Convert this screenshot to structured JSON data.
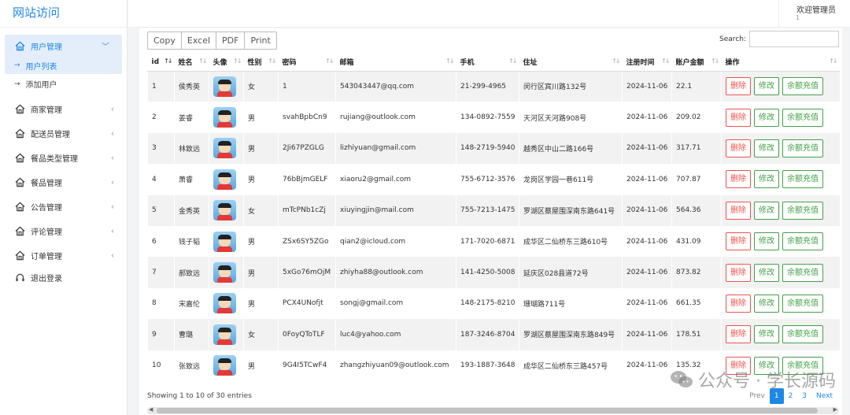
{
  "sidebar": {
    "logo": "网站访问",
    "items": [
      {
        "label": "用户管理",
        "icon": "home-icon",
        "expanded": true
      },
      {
        "label": "商家管理",
        "icon": "home-icon"
      },
      {
        "label": "配送员管理",
        "icon": "home-icon"
      },
      {
        "label": "餐品类型管理",
        "icon": "home-icon"
      },
      {
        "label": "餐品管理",
        "icon": "home-icon"
      },
      {
        "label": "公告管理",
        "icon": "home-icon"
      },
      {
        "label": "评论管理",
        "icon": "home-icon"
      },
      {
        "label": "订单管理",
        "icon": "home-icon"
      },
      {
        "label": "退出登录",
        "icon": "headset-icon"
      }
    ],
    "sub_items": [
      {
        "label": "用户列表"
      },
      {
        "label": "添加用户"
      }
    ]
  },
  "header": {
    "welcome": "欢迎管理员",
    "sub": "1"
  },
  "toolbar": {
    "copy": "Copy",
    "excel": "Excel",
    "pdf": "PDF",
    "print": "Print",
    "search_label": "Search:",
    "search_value": ""
  },
  "table": {
    "columns": [
      "id",
      "姓名",
      "头像",
      "性别",
      "密码",
      "邮箱",
      "手机",
      "住址",
      "注册时间",
      "账户金额",
      "操作"
    ],
    "rows": [
      {
        "id": "1",
        "name": "侯秀英",
        "gender": "女",
        "password": "1",
        "email": "543043447@qq.com",
        "phone": "21-299-4965",
        "address": "闵行区宾川路132号",
        "date": "2024-11-06",
        "balance": "22.1"
      },
      {
        "id": "2",
        "name": "姜睿",
        "gender": "男",
        "password": "svahBpbCn9",
        "email": "rujiang@outlook.com",
        "phone": "134-0892-7559",
        "address": "天河区天河路908号",
        "date": "2024-11-06",
        "balance": "209.02"
      },
      {
        "id": "3",
        "name": "林致远",
        "gender": "男",
        "password": "2Ji67PZGLG",
        "email": "lizhiyuan@gmail.com",
        "phone": "148-2719-5940",
        "address": "越秀区中山二路166号",
        "date": "2024-11-06",
        "balance": "317.71"
      },
      {
        "id": "4",
        "name": "萧睿",
        "gender": "男",
        "password": "76bBjmGELF",
        "email": "xiaoru2@gmail.com",
        "phone": "755-6712-3576",
        "address": "龙岗区学园一巷611号",
        "date": "2024-11-06",
        "balance": "707.87"
      },
      {
        "id": "5",
        "name": "金秀英",
        "gender": "女",
        "password": "mTcPNb1cZj",
        "email": "xiuyingjin@mail.com",
        "phone": "755-7213-1475",
        "address": "罗湖区蔡屋围深南东路641号",
        "date": "2024-11-06",
        "balance": "564.36"
      },
      {
        "id": "6",
        "name": "钱子韬",
        "gender": "男",
        "password": "ZSx6SY5ZGo",
        "email": "qian2@icloud.com",
        "phone": "171-7020-6871",
        "address": "成华区二仙桥东三路610号",
        "date": "2024-11-06",
        "balance": "431.09"
      },
      {
        "id": "7",
        "name": "郝致远",
        "gender": "男",
        "password": "5xGo76mOjM",
        "email": "zhiyha88@outlook.com",
        "phone": "141-4250-5008",
        "address": "延庆区028县道72号",
        "date": "2024-11-06",
        "balance": "873.82"
      },
      {
        "id": "8",
        "name": "宋嘉伦",
        "gender": "男",
        "password": "PCX4UNofjt",
        "email": "songj@gmail.com",
        "phone": "148-2175-8210",
        "address": "珊瑚路711号",
        "date": "2024-11-06",
        "balance": "661.35"
      },
      {
        "id": "9",
        "name": "曹璐",
        "gender": "女",
        "password": "0FoyQToTLF",
        "email": "luc4@yahoo.com",
        "phone": "187-3246-8704",
        "address": "罗湖区蔡屋围深南东路849号",
        "date": "2024-11-06",
        "balance": "178.51"
      },
      {
        "id": "10",
        "name": "张致远",
        "gender": "男",
        "password": "9G4I5TCwF4",
        "email": "zhangzhiyuan09@outlook.com",
        "phone": "193-1887-3648",
        "address": "成华区二仙桥东三路457号",
        "date": "2024-11-06",
        "balance": "135.32"
      }
    ],
    "actions": {
      "delete": "删除",
      "edit": "修改",
      "recharge": "余额充值"
    }
  },
  "footer": {
    "info": "Showing 1 to 10 of 30 entries",
    "prev": "Prev",
    "pages": [
      "1",
      "2",
      "3"
    ],
    "current_page": "1",
    "next": "Next"
  },
  "watermark": "公众号 · 学长源码",
  "colors": {
    "accent": "#1e88e5",
    "danger": "#ef5350",
    "success": "#43a047"
  }
}
